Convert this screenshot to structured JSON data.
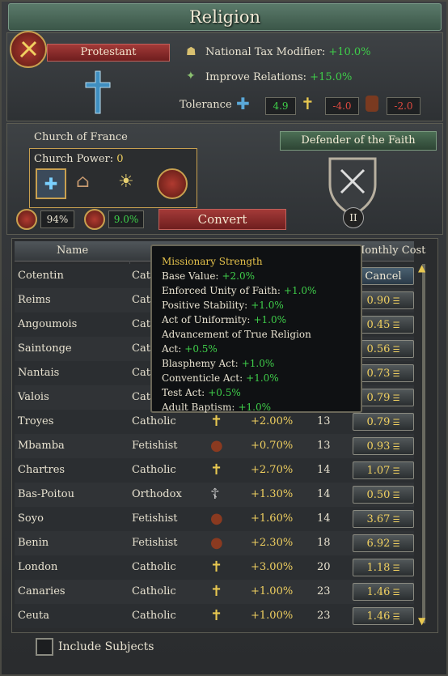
{
  "window": {
    "title": "Religion"
  },
  "religion": {
    "name": "Protestant",
    "national_tax_modifier_label": "National Tax Modifier:",
    "national_tax_modifier_value": "+10.0%",
    "improve_relations_label": "Improve Relations:",
    "improve_relations_value": "+15.0%",
    "tolerance_label": "Tolerance",
    "tolerance_own": "4.9",
    "tolerance_heretic": "-4.0",
    "tolerance_heathen": "-2.0"
  },
  "church": {
    "name": "Church of France",
    "power_label": "Church Power:",
    "power_value": "0"
  },
  "defender": {
    "label": "Defender of the Faith",
    "rank": "II"
  },
  "stats": {
    "unity": "94%",
    "missionary": "9.0%",
    "convert_label": "Convert"
  },
  "table": {
    "headers": {
      "name": "Name",
      "cost": "Monthly Cost"
    },
    "rows": [
      {
        "name": "Cotentin",
        "religion": "Cat",
        "cost": "Cancel"
      },
      {
        "name": "Reims",
        "religion": "Cat",
        "cost": "0.90"
      },
      {
        "name": "Angoumois",
        "religion": "Cat",
        "cost": "0.45"
      },
      {
        "name": "Saintonge",
        "religion": "Cat",
        "cost": "0.56"
      },
      {
        "name": "Nantais",
        "religion": "Cat",
        "cost": "0.73"
      },
      {
        "name": "Valois",
        "religion": "Cat",
        "cost": "0.79"
      },
      {
        "name": "Troyes",
        "religion": "Catholic",
        "chance": "+2.00%",
        "time": "13",
        "cost": "0.79"
      },
      {
        "name": "Mbamba",
        "religion": "Fetishist",
        "chance": "+0.70%",
        "time": "13",
        "cost": "0.93"
      },
      {
        "name": "Chartres",
        "religion": "Catholic",
        "chance": "+2.70%",
        "time": "14",
        "cost": "1.07"
      },
      {
        "name": "Bas-Poitou",
        "religion": "Orthodox",
        "chance": "+1.30%",
        "time": "14",
        "cost": "0.50"
      },
      {
        "name": "Soyo",
        "religion": "Fetishist",
        "chance": "+1.60%",
        "time": "14",
        "cost": "3.67"
      },
      {
        "name": "Benin",
        "religion": "Fetishist",
        "chance": "+2.30%",
        "time": "18",
        "cost": "6.92"
      },
      {
        "name": "London",
        "religion": "Catholic",
        "chance": "+3.00%",
        "time": "20",
        "cost": "1.18"
      },
      {
        "name": "Canaries",
        "religion": "Catholic",
        "chance": "+1.00%",
        "time": "23",
        "cost": "1.46"
      },
      {
        "name": "Ceuta",
        "religion": "Catholic",
        "chance": "+1.00%",
        "time": "23",
        "cost": "1.46"
      }
    ]
  },
  "tooltip": {
    "title": "Missionary Strength",
    "lines": [
      {
        "label": "Base Value:",
        "value": "+2.0%"
      },
      {
        "label": "Enforced Unity of Faith:",
        "value": "+1.0%"
      },
      {
        "label": "Positive Stability:",
        "value": "+1.0%"
      },
      {
        "label": "Act of Uniformity:",
        "value": "+1.0%"
      },
      {
        "label": "Advancement of True Religion Act:",
        "value": "+0.5%"
      },
      {
        "label": "Blasphemy Act:",
        "value": "+1.0%"
      },
      {
        "label": "Conventicle Act:",
        "value": "+1.0%"
      },
      {
        "label": "Test Act:",
        "value": "+0.5%"
      },
      {
        "label": "Adult Baptism:",
        "value": "+1.0%"
      }
    ]
  },
  "footer": {
    "include_subjects_label": "Include Subjects"
  },
  "colors": {
    "positive": "#3fcf4a",
    "negative": "#e04a40",
    "gold": "#f0d060"
  }
}
